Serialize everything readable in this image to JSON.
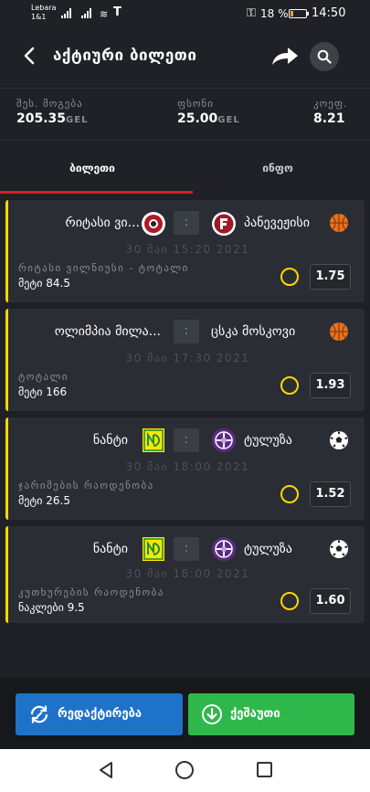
{
  "status_bar": {
    "carrier_line1": "Lebara",
    "carrier_line2": "1&1",
    "battery": "18 %",
    "time": "14:50"
  },
  "header": {
    "title": "აქტიური ბილეთი"
  },
  "summary": {
    "win_label": "შეს. მოგება",
    "win_value": "205.35",
    "win_unit": "GEL",
    "stake_label": "ფსონი",
    "stake_value": "25.00",
    "stake_unit": "GEL",
    "odds_label": "კოეფ.",
    "odds_value": "8.21"
  },
  "tabs": {
    "ticket": "ბილეთი",
    "info": "ინფო"
  },
  "bets": [
    {
      "home": "რიტასი ვი...",
      "away": "პანევეჟისი",
      "sport": "basketball",
      "date": "30 მაი 15:20 2021",
      "market": "რიტასი ვილნიუსი - ტოტალი",
      "selection": "მეტი 84.5",
      "odds": "1.75"
    },
    {
      "home": "ოლიმპია მილა...",
      "away": "ცსკა მოსკოვი",
      "sport": "basketball",
      "date": "30 მაი 17:30 2021",
      "market": "ტოტალი",
      "selection": "მეტი 166",
      "odds": "1.93"
    },
    {
      "home": "ნანტი",
      "away": "ტულუზა",
      "sport": "football",
      "date": "30 მაი 18:00 2021",
      "market": "ჯარიმების რაოდენობა",
      "selection": "მეტი 26.5",
      "odds": "1.52"
    },
    {
      "home": "ნანტი",
      "away": "ტულუზა",
      "sport": "football",
      "date": "30 მაი 18:00 2021",
      "market": "კუთხურების რაოდენობა",
      "selection": "ნაკლები 9.5",
      "odds": "1.60"
    }
  ],
  "separator": ":",
  "buttons": {
    "edit": "რედაქტირება",
    "bet": "ქეშაუთი"
  },
  "colors": {
    "accent_yellow": "#ffd700",
    "accent_red": "#e2192c",
    "edit_blue": "#1e72c8",
    "bet_green": "#2eb84b"
  }
}
